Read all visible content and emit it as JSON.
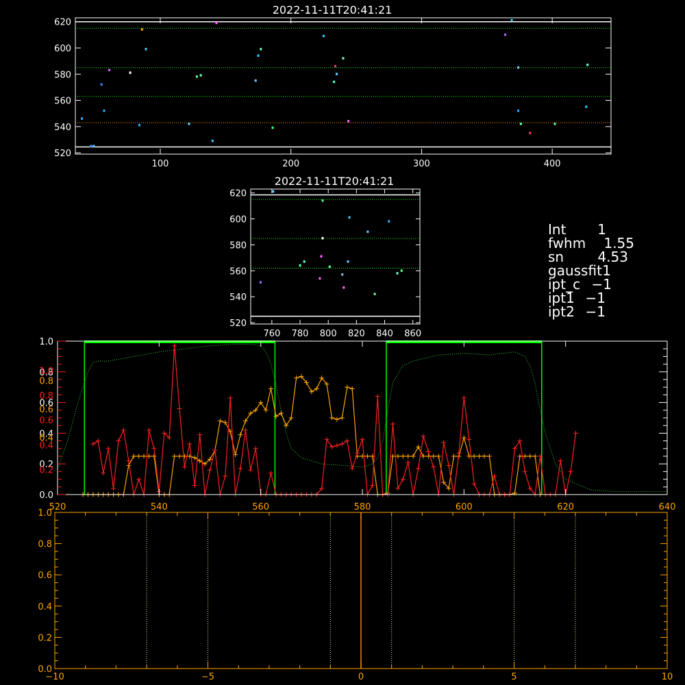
{
  "colors": {
    "background": "#000000",
    "white": "#ffffff",
    "green": "#00ff00",
    "dotted_green": "#33cc33",
    "red": "#ff2020",
    "orange": "#ffa500",
    "dark_orange": "#ff7f00"
  },
  "info_panel": {
    "int_label": "Int",
    "int_value": "1",
    "fwhm_label": "fwhm",
    "fwhm_value": "1.55",
    "sn_label": "sn",
    "sn_value": "4.53",
    "gaussfit_label": "gaussfit",
    "gaussfit_value": "1",
    "ipt_c_label": "ipt_c",
    "ipt_c_value": "−1",
    "ipt1_label": "ipt1",
    "ipt1_value": "−1",
    "ipt2_label": "ipt2",
    "ipt2_value": "−1"
  },
  "chart_data": [
    {
      "id": "top-image",
      "type": "scatter",
      "title": "2022-11-11T20:41:21",
      "xlim": [
        35,
        445
      ],
      "ylim": [
        519,
        623
      ],
      "xticks": [
        100,
        200,
        300,
        400
      ],
      "yticks": [
        520,
        540,
        560,
        580,
        600,
        620
      ],
      "hlines": [
        {
          "y": 620,
          "color": "white",
          "dotted": false
        },
        {
          "y": 524.5,
          "color": "white",
          "dotted": false
        },
        {
          "y": 615,
          "color": "green",
          "dotted": true
        },
        {
          "y": 585,
          "color": "green",
          "dotted": true
        },
        {
          "y": 563,
          "color": "green",
          "dotted": true
        },
        {
          "y": 543,
          "color": "orange",
          "dotted": true
        }
      ],
      "points": [
        {
          "x": 40,
          "y": 546,
          "c": "#33aaff"
        },
        {
          "x": 47,
          "y": 525,
          "c": "#3399ff"
        },
        {
          "x": 49,
          "y": 525,
          "c": "#66ccff"
        },
        {
          "x": 55,
          "y": 572,
          "c": "#4488ff"
        },
        {
          "x": 57,
          "y": 552,
          "c": "#33aaff"
        },
        {
          "x": 61,
          "y": 583,
          "c": "#cc66ff"
        },
        {
          "x": 77,
          "y": 581,
          "c": "#ffffff"
        },
        {
          "x": 84,
          "y": 541,
          "c": "#33aaff"
        },
        {
          "x": 86,
          "y": 614,
          "c": "#ffaa00"
        },
        {
          "x": 89,
          "y": 599,
          "c": "#44ccff"
        },
        {
          "x": 122,
          "y": 542,
          "c": "#66ccff"
        },
        {
          "x": 128,
          "y": 578,
          "c": "#66ff99"
        },
        {
          "x": 131,
          "y": 579,
          "c": "#66ffcc"
        },
        {
          "x": 140,
          "y": 529,
          "c": "#33ccff"
        },
        {
          "x": 143,
          "y": 619,
          "c": "#ff66ff"
        },
        {
          "x": 173,
          "y": 575,
          "c": "#66ccff"
        },
        {
          "x": 175,
          "y": 594,
          "c": "#33ccff"
        },
        {
          "x": 177,
          "y": 599,
          "c": "#66ffaa"
        },
        {
          "x": 186,
          "y": 539,
          "c": "#44ff88"
        },
        {
          "x": 225,
          "y": 609,
          "c": "#33ccff"
        },
        {
          "x": 233,
          "y": 574,
          "c": "#66ffcc"
        },
        {
          "x": 234,
          "y": 586,
          "c": "#ff3366"
        },
        {
          "x": 235,
          "y": 580,
          "c": "#66ccff"
        },
        {
          "x": 240,
          "y": 592,
          "c": "#66ffcc"
        },
        {
          "x": 244,
          "y": 544,
          "c": "#ff66ff"
        },
        {
          "x": 364,
          "y": 610,
          "c": "#aa66ff"
        },
        {
          "x": 369,
          "y": 621,
          "c": "#33ccff"
        },
        {
          "x": 374,
          "y": 552,
          "c": "#33aaff"
        },
        {
          "x": 374,
          "y": 585,
          "c": "#66ccff"
        },
        {
          "x": 376,
          "y": 542,
          "c": "#66ff99"
        },
        {
          "x": 383,
          "y": 535,
          "c": "#ff3366"
        },
        {
          "x": 402,
          "y": 542,
          "c": "#66ff99"
        },
        {
          "x": 426,
          "y": 555,
          "c": "#33ccff"
        },
        {
          "x": 427,
          "y": 587,
          "c": "#66ffcc"
        }
      ]
    },
    {
      "id": "mid-image",
      "type": "scatter",
      "title": "2022-11-11T20:41:21",
      "xlim": [
        745,
        865
      ],
      "ylim": [
        519,
        623
      ],
      "xticks": [
        760,
        780,
        800,
        820,
        840,
        860
      ],
      "yticks": [
        520,
        540,
        560,
        580,
        600,
        620
      ],
      "hlines": [
        {
          "y": 618.5,
          "color": "white",
          "dotted": false
        },
        {
          "y": 525,
          "color": "white",
          "dotted": false
        },
        {
          "y": 615,
          "color": "green",
          "dotted": true
        },
        {
          "y": 585,
          "color": "green",
          "dotted": true
        },
        {
          "y": 562,
          "color": "green",
          "dotted": true
        }
      ],
      "points": [
        {
          "x": 752,
          "y": 551,
          "c": "#aa66ff"
        },
        {
          "x": 761,
          "y": 621,
          "c": "#66ccff"
        },
        {
          "x": 780,
          "y": 564,
          "c": "#66ffaa"
        },
        {
          "x": 783,
          "y": 567,
          "c": "#66ffcc"
        },
        {
          "x": 794,
          "y": 554,
          "c": "#ff66ff"
        },
        {
          "x": 795,
          "y": 571,
          "c": "#ff66ff"
        },
        {
          "x": 796,
          "y": 585,
          "c": "#ffffff"
        },
        {
          "x": 796,
          "y": 614,
          "c": "#44ff88"
        },
        {
          "x": 801,
          "y": 563,
          "c": "#66ff99"
        },
        {
          "x": 810,
          "y": 557,
          "c": "#66ccff"
        },
        {
          "x": 811,
          "y": 547,
          "c": "#ff66ff"
        },
        {
          "x": 814,
          "y": 567,
          "c": "#66ccff"
        },
        {
          "x": 815,
          "y": 601,
          "c": "#44ccff"
        },
        {
          "x": 828,
          "y": 590,
          "c": "#66ccff"
        },
        {
          "x": 833,
          "y": 542,
          "c": "#66ff99"
        },
        {
          "x": 843,
          "y": 598,
          "c": "#33aaff"
        },
        {
          "x": 849,
          "y": 558,
          "c": "#66ffcc"
        },
        {
          "x": 852,
          "y": 560,
          "c": "#66ff99"
        }
      ]
    },
    {
      "id": "profile-plot",
      "type": "line",
      "xlim": [
        520,
        640
      ],
      "ylim": [
        0,
        1
      ],
      "xticks": [
        520,
        540,
        560,
        580,
        600,
        620,
        640
      ],
      "yticks_white": [
        "0.0",
        "0.2",
        "0.4",
        "0.6",
        "0.8",
        "1.0"
      ],
      "yticks_orange": [
        "0.4",
        "0.6",
        "0.8"
      ],
      "yticks_red": [
        "0.2",
        "0.4",
        "0.6",
        "0.8",
        "1.0"
      ],
      "windows": [
        [
          525.3,
          562.8
        ],
        [
          584.7,
          615.3
        ]
      ],
      "series": [
        {
          "color": "green",
          "style": "dotted",
          "x": [
            520,
            522,
            524,
            526,
            527,
            528,
            530,
            535,
            540,
            545,
            550,
            555,
            558,
            560,
            561,
            562,
            563,
            564,
            565,
            566,
            568,
            572,
            576,
            580,
            582,
            583,
            584,
            585,
            586,
            588,
            590,
            595,
            600,
            605,
            610,
            612,
            613,
            614,
            615,
            616,
            617,
            618,
            620,
            625,
            630,
            635,
            640
          ],
          "y": [
            0.17,
            0.35,
            0.6,
            0.8,
            0.86,
            0.87,
            0.87,
            0.9,
            0.93,
            0.95,
            0.97,
            0.98,
            0.98,
            0.97,
            0.93,
            0.85,
            0.72,
            0.55,
            0.4,
            0.3,
            0.24,
            0.2,
            0.19,
            0.18,
            0.2,
            0.24,
            0.35,
            0.55,
            0.73,
            0.84,
            0.87,
            0.91,
            0.92,
            0.91,
            0.93,
            0.9,
            0.84,
            0.72,
            0.55,
            0.4,
            0.3,
            0.2,
            0.1,
            0.03,
            0.02,
            0.02,
            0.02
          ]
        },
        {
          "color": "orange",
          "style": "plus",
          "x": [
            525,
            526,
            527,
            528,
            529,
            530,
            531,
            532,
            533,
            534,
            535,
            536,
            537,
            538,
            539,
            540,
            541,
            542,
            543,
            544,
            545,
            546,
            547,
            548,
            549,
            550,
            551,
            552,
            553,
            554,
            555,
            556,
            557,
            558,
            559,
            560,
            561,
            562,
            563,
            564,
            565,
            566,
            567,
            568,
            569,
            570,
            571,
            572,
            573,
            574,
            575,
            576,
            577,
            578,
            579,
            580,
            581,
            582,
            583,
            584,
            585,
            586,
            587,
            588,
            589,
            590,
            591,
            592,
            593,
            594,
            595,
            596,
            597,
            598,
            599,
            600,
            601,
            602,
            603,
            604,
            605,
            606,
            607,
            608,
            609,
            610,
            611,
            612,
            613,
            614,
            615
          ],
          "y": [
            0.0,
            0.0,
            0.0,
            0.0,
            0.0,
            0.0,
            0.0,
            0.0,
            0.0,
            0.19,
            0.25,
            0.25,
            0.25,
            0.25,
            0.25,
            0.0,
            0.0,
            0.0,
            0.25,
            0.25,
            0.25,
            0.25,
            0.24,
            0.22,
            0.2,
            0.23,
            0.29,
            0.48,
            0.47,
            0.41,
            0.26,
            0.39,
            0.48,
            0.53,
            0.55,
            0.6,
            0.55,
            0.69,
            0.51,
            0.53,
            0.45,
            0.5,
            0.76,
            0.77,
            0.73,
            0.67,
            0.69,
            0.76,
            0.72,
            0.5,
            0.49,
            0.5,
            0.7,
            0.69,
            0.25,
            0.25,
            0.25,
            0.25,
            0.0,
            0.0,
            0.01,
            0.25,
            0.25,
            0.25,
            0.25,
            0.25,
            0.31,
            0.25,
            0.25,
            0.25,
            0.25,
            0.08,
            0.04,
            0.25,
            0.25,
            0.37,
            0.25,
            0.25,
            0.25,
            0.25,
            0.25,
            0.0,
            0.0,
            0.0,
            0.0,
            0.01,
            0.25,
            0.25,
            0.25,
            0.25,
            0.0
          ]
        },
        {
          "color": "red",
          "style": "plus",
          "x": [
            527,
            528,
            529,
            530,
            531,
            532,
            533,
            534,
            535,
            536,
            537,
            538,
            539,
            540,
            541,
            542,
            543,
            544,
            545,
            546,
            547,
            548,
            549,
            550,
            551,
            552,
            553,
            554,
            555,
            556,
            557,
            558,
            559,
            560,
            561,
            562,
            563,
            564,
            565,
            566,
            567,
            568,
            569,
            570,
            571,
            572,
            573,
            574,
            575,
            576,
            577,
            578,
            579,
            580,
            581,
            582,
            583,
            584,
            585,
            586,
            587,
            588,
            589,
            590,
            591,
            592,
            593,
            594,
            595,
            596,
            597,
            598,
            599,
            600,
            601,
            602,
            603,
            604,
            605,
            606,
            607,
            608,
            609,
            610,
            611,
            612,
            613,
            614,
            615,
            616,
            617,
            618,
            619,
            620,
            621,
            622
          ],
          "y": [
            0.33,
            0.35,
            0.14,
            0.3,
            0.04,
            0.35,
            0.42,
            0.22,
            0.0,
            0.1,
            0.0,
            0.42,
            0.3,
            0.02,
            0.4,
            0.37,
            0.97,
            0.56,
            0.18,
            0.33,
            0.06,
            0.39,
            0.0,
            0.16,
            0.29,
            0.0,
            0.12,
            0.63,
            0.0,
            0.17,
            0.42,
            0.16,
            0.3,
            0.0,
            0.0,
            0.14,
            0.0,
            0.0,
            0.0,
            0.0,
            0.0,
            0.0,
            0.0,
            0.0,
            0.0,
            0.04,
            0.36,
            0.31,
            0.32,
            0.33,
            0.35,
            0.17,
            0.27,
            0.36,
            0.0,
            0.06,
            0.64,
            0.0,
            0.0,
            0.46,
            0.04,
            0.1,
            0.21,
            0.0,
            0.17,
            0.38,
            0.28,
            0.18,
            0.0,
            0.34,
            0.19,
            0.0,
            0.27,
            0.63,
            0.36,
            0.07,
            0.0,
            0.0,
            0.0,
            0.12,
            0.0,
            0.0,
            0.0,
            0.3,
            0.35,
            0.15,
            0.04,
            0.0,
            0.25,
            0.0,
            0.0,
            0.0,
            0.22,
            0.0,
            0.15,
            0.4
          ]
        }
      ]
    },
    {
      "id": "bottom-plot",
      "type": "line",
      "xlim": [
        -10,
        10
      ],
      "ylim": [
        0,
        1
      ],
      "xticks": [
        "−10",
        "−5",
        "0",
        "5",
        "10"
      ],
      "xtick_values": [
        -10,
        -5,
        0,
        5,
        10
      ],
      "yticks": [
        "0.0",
        "0.2",
        "0.4",
        "0.6",
        "0.8",
        "1.0"
      ],
      "vlines_dotted": [
        -7,
        -5,
        -1,
        1,
        5,
        7
      ],
      "vline_solid": 0
    }
  ]
}
